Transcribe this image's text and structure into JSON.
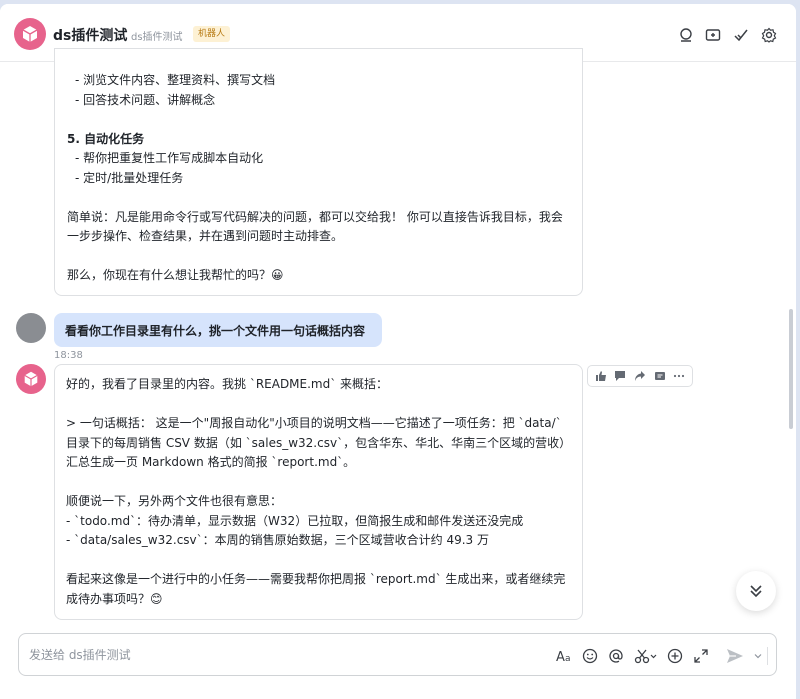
{
  "header": {
    "title": "ds插件测试",
    "subtitle": "ds插件测试",
    "badge": "机器人"
  },
  "message1": {
    "lines": [
      "- 浏览文件内容、整理资料、撰写文档",
      "- 回答技术问题、讲解概念",
      "",
      "5. 自动化任务",
      "- 帮你把重复性工作写成脚本自动化",
      "- 定时/批量处理任务",
      "",
      "简单说：凡是能用命令行或写代码解决的问题，都可以交给我！ 你可以直接告诉我目标，我会",
      "一步步操作、检查结果，并在遇到问题时主动排查。",
      "",
      "那么，你现在有什么想让我帮忙的吗？😀"
    ]
  },
  "user_message": {
    "text": "看看你工作目录里有什么，挑一个文件用一句话概括内容",
    "time": "18:38"
  },
  "message2": {
    "lines": [
      "好的，我看了目录里的内容。我挑 `README.md` 来概括：",
      "",
      "> 一句话概括：  这是一个\"周报自动化\"小项目的说明文档——它描述了一项任务：把 `data/`",
      "目录下的每周销售 CSV 数据（如 `sales_w32.csv`，包含华东、华北、华南三个区域的营收）",
      "汇总生成一页 Markdown 格式的简报 `report.md`。",
      "",
      "顺便说一下，另外两个文件也很有意思：",
      "- `todo.md`：待办清单，显示数据（W32）已拉取，但简报生成和邮件发送还没完成",
      "- `data/sales_w32.csv`：本周的销售原始数据，三个区域营收合计约 49.3 万",
      "",
      "看起来这像是一个进行中的小任务——需要我帮你把周报 `report.md` 生成出来，或者继续完",
      "成待办事项吗？😊"
    ]
  },
  "input": {
    "placeholder": "发送给 ds插件测试"
  },
  "icons": {
    "header": [
      "search-icon",
      "add-window-icon",
      "check-icon",
      "settings-icon"
    ],
    "actions": [
      "thumbs-up-icon",
      "comment-icon",
      "forward-icon",
      "quote-icon",
      "more-icon"
    ],
    "toolbar": [
      "font-icon",
      "emoji-icon",
      "mention-icon",
      "screenshot-icon",
      "add-icon",
      "expand-icon",
      "send-icon",
      "send-options-icon"
    ]
  },
  "colors": {
    "bot_avatar": "#e7638c",
    "user_bubble": "#d6e4fc",
    "badge_bg": "#fdf1d4",
    "badge_text": "#b77a12"
  }
}
